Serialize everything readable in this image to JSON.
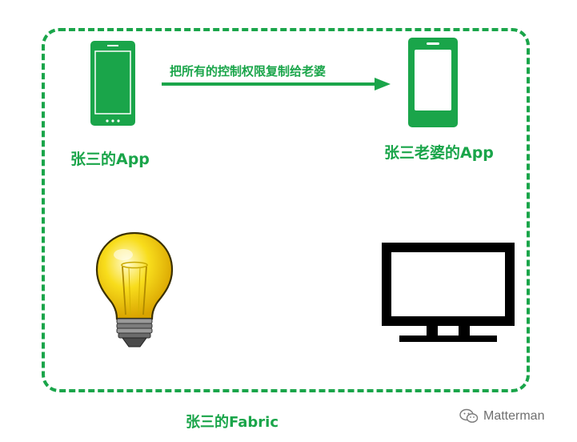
{
  "colors": {
    "accent_green": "#1aa54a",
    "bulb_yellow": "#f6d200",
    "tv_black": "#000000"
  },
  "diagram": {
    "fabric_label": "张三的Fabric",
    "arrow_label": "把所有的控制权限复制给老婆",
    "nodes": {
      "zhangsan_app": {
        "label": "张三的App",
        "icon": "phone-icon"
      },
      "wife_app": {
        "label": "张三老婆的App",
        "icon": "phone-icon"
      },
      "light": {
        "icon": "light-bulb-icon"
      },
      "tv": {
        "icon": "tv-icon"
      }
    }
  },
  "watermark": {
    "text": "Matterman",
    "icon": "wechat-icon"
  }
}
